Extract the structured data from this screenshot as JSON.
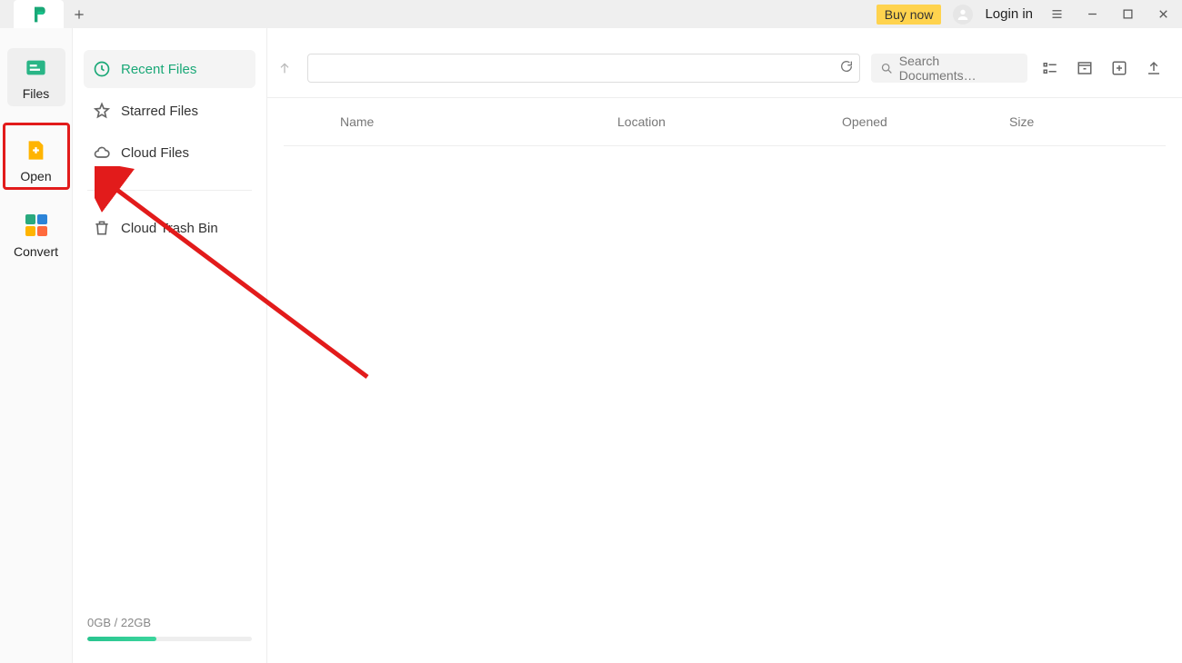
{
  "titlebar": {
    "buy_label": "Buy now",
    "login_label": "Login in"
  },
  "rail": {
    "items": [
      {
        "id": "files",
        "label": "Files"
      },
      {
        "id": "open",
        "label": "Open"
      },
      {
        "id": "convert",
        "label": "Convert"
      }
    ]
  },
  "sidebar": {
    "items": [
      {
        "id": "recent",
        "label": "Recent Files"
      },
      {
        "id": "starred",
        "label": "Starred Files"
      },
      {
        "id": "cloud",
        "label": "Cloud Files"
      },
      {
        "id": "trash",
        "label": "Cloud Trash Bin"
      }
    ]
  },
  "topbar": {
    "search_placeholder": "Search Documents…"
  },
  "table": {
    "columns": {
      "name": "Name",
      "location": "Location",
      "opened": "Opened",
      "size": "Size"
    },
    "rows": []
  },
  "storage": {
    "text": "0GB / 22GB",
    "used_gb": 0,
    "total_gb": 22
  },
  "colors": {
    "accent": "#1aa877",
    "highlight_border": "#e21b1b",
    "buy_bg": "#ffd34e"
  }
}
